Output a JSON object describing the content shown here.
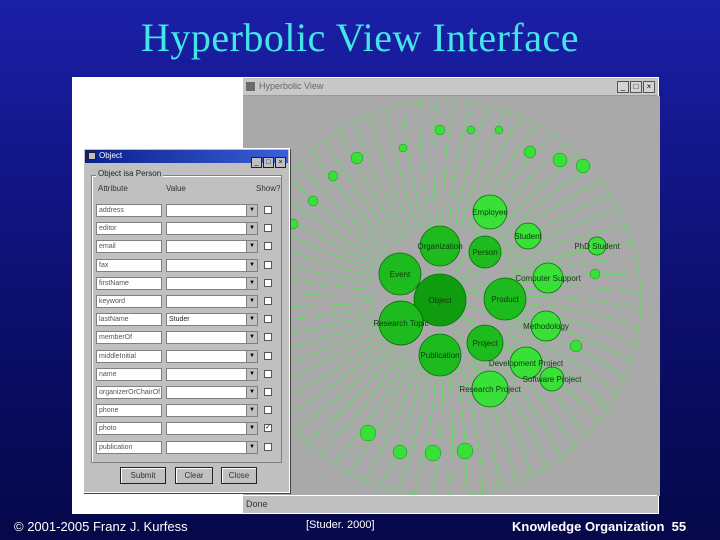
{
  "slide": {
    "title": "Hyperbolic View Interface",
    "footer_copyright": "© 2001-2005 Franz J. Kurfess",
    "footer_citation": "[Studer. 2000]",
    "footer_course": "Knowledge Organization",
    "footer_page": "55"
  },
  "hyperbolic_window": {
    "title": "Hyperbolic View",
    "status_text": "Done",
    "controls": {
      "minimize": "_",
      "maximize": "□",
      "close": "×"
    },
    "colors": {
      "background": "#a9a9a9",
      "edge": "#58e058",
      "node_center": "#0f9d0f",
      "node_inner": "#1dbb1d",
      "node_outer": "#38e038"
    },
    "nodes": {
      "center": "Object",
      "employee": "Employee",
      "student": "Student",
      "organization": "Organization",
      "person": "Person",
      "event": "Event",
      "product": "Product",
      "computer_support": "Computer Support",
      "research_topic": "Research Topic",
      "methodology": "Methodology",
      "project": "Project",
      "publication": "Publication",
      "development_project": "Development Project",
      "research_project": "Research Project",
      "software_project": "Software Project",
      "phd_student": "PhD Student"
    }
  },
  "object_dialog": {
    "title": "Object",
    "group_label": "Object  isa Person",
    "controls": {
      "minimize": "_",
      "maximize": "□",
      "close": "×"
    },
    "columns": {
      "attribute": "Attribute",
      "value": "Value",
      "show": "Show?"
    },
    "rows": [
      {
        "label": "address",
        "value": "",
        "checked": false
      },
      {
        "label": "editor",
        "value": "",
        "checked": false
      },
      {
        "label": "email",
        "value": "",
        "checked": false
      },
      {
        "label": "fax",
        "value": "",
        "checked": false
      },
      {
        "label": "firstName",
        "value": "",
        "checked": false
      },
      {
        "label": "keyword",
        "value": "",
        "checked": false
      },
      {
        "label": "lastName",
        "value": "Studer",
        "checked": false
      },
      {
        "label": "memberOf",
        "value": "",
        "checked": false
      },
      {
        "label": "middleInitial",
        "value": "",
        "checked": false
      },
      {
        "label": "name",
        "value": "",
        "checked": false
      },
      {
        "label": "organizerOrChairOf",
        "value": "",
        "checked": false
      },
      {
        "label": "phone",
        "value": "",
        "checked": false
      },
      {
        "label": "photo",
        "value": "",
        "checked": true
      },
      {
        "label": "publication",
        "value": "",
        "checked": false
      }
    ],
    "buttons": {
      "submit": "Submit",
      "clear": "Clear",
      "close": "Close"
    }
  }
}
